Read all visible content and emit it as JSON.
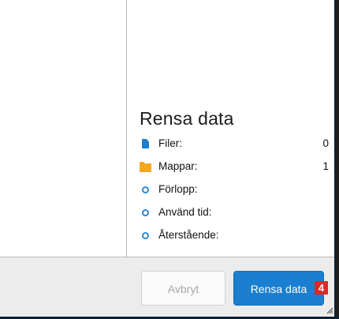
{
  "section": {
    "title": "Rensa data"
  },
  "stats": [
    {
      "icon": "file-icon",
      "label": "Filer:",
      "value": "0"
    },
    {
      "icon": "folder-icon",
      "label": "Mappar:",
      "value": "1"
    },
    {
      "icon": "progress-circle-icon",
      "label": "Förlopp:",
      "value": ""
    },
    {
      "icon": "elapsed-circle-icon",
      "label": "Använd tid:",
      "value": ""
    },
    {
      "icon": "remaining-circle-icon",
      "label": "Återstående:",
      "value": ""
    }
  ],
  "footer": {
    "cancel_label": "Avbryt",
    "clear_label": "Rensa data",
    "badge": "4"
  },
  "colors": {
    "accent": "#1a7fd0",
    "folder": "#f5a623",
    "badge": "#d82a2a"
  }
}
